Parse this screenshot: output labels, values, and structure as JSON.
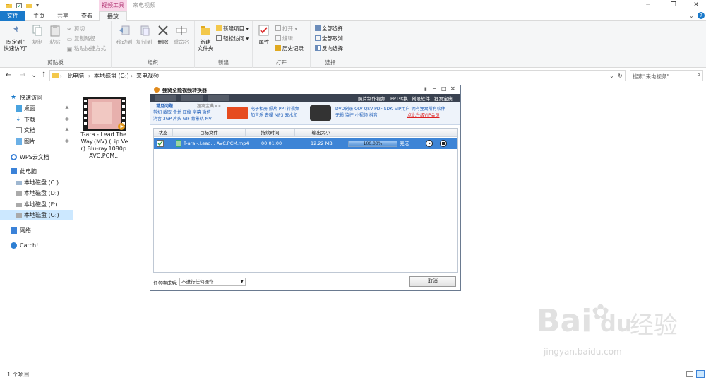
{
  "titlebar": {
    "context_tab": "视频工具",
    "window_title": "来电视频",
    "minimize": "─",
    "maximize": "❐",
    "close": "✕"
  },
  "tabs": [
    "文件",
    "主页",
    "共享",
    "查看",
    "播放"
  ],
  "ribbon": {
    "clipboard": {
      "label": "剪贴板",
      "pin": "固定到\"\n快速访问\"",
      "copy": "复制",
      "paste": "粘贴",
      "cut": "剪切",
      "copy_path": "复制路径",
      "paste_shortcut": "粘贴快捷方式"
    },
    "organize": {
      "label": "组织",
      "move_to": "移动到",
      "copy_to": "复制到",
      "delete": "删除",
      "rename": "重命名"
    },
    "new": {
      "label": "新建",
      "new_folder": "新建\n文件夹",
      "new_item": "新建项目 ▾",
      "easy_access": "轻松访问 ▾"
    },
    "open": {
      "label": "打开",
      "properties": "属性",
      "open": "打开 ▾",
      "edit": "编辑",
      "history": "历史记录"
    },
    "select": {
      "label": "选择",
      "select_all": "全部选择",
      "select_none": "全部取消",
      "invert": "反向选择"
    }
  },
  "address": {
    "back": "←",
    "forward": "→",
    "recent": "⌄",
    "up": "↑",
    "crumbs": [
      "此电脑",
      "本地磁盘 (G:)",
      "来电视频"
    ],
    "search_placeholder": "搜索\"来电视频\""
  },
  "nav": {
    "quick_access": "快速访问",
    "desktop": "桌面",
    "downloads": "下载",
    "documents": "文档",
    "pictures": "图片",
    "wps": "WPS云文档",
    "this_pc": "此电脑",
    "drive_c": "本地磁盘 (C:)",
    "drive_d": "本地磁盘 (D:)",
    "drive_f": "本地磁盘 (F:)",
    "drive_g": "本地磁盘 (G:)",
    "network": "网络",
    "catch": "Catch!"
  },
  "file": {
    "name": "T-ara.-.Lead.The.Way.(MV).(Lip.Ver).Blu-ray.1080p.AVC.PCM..."
  },
  "converter": {
    "title": "狸窝全能视频转换器",
    "links": [
      "照片制作视频",
      "PPT转换",
      "刻录软件",
      "狸窝宝典"
    ],
    "ad": {
      "tab1": "常见问题",
      "tab2": "狸窝宝典>>",
      "row1": "剪切 截取 合并 压缩 字幕 微信",
      "row2": "消音 3GP 片头 GIF 背景轨 MV",
      "mid1": "电子相册 照片 PPT转视频",
      "mid2": "加音乐 去噪 MP3 去水印",
      "right1": "DVD刻录 QLV QSV PDF SDK",
      "right2": "无损 监控 小视频 抖音",
      "vip1": "VIP用户-拥有狸窝所有软件",
      "vip2": "点此升级VIP会员"
    },
    "columns": [
      "状态",
      "目标文件",
      "持续时间",
      "输出大小"
    ],
    "row": {
      "file": "T-ara.-.Lead... AVC.PCM.mp4",
      "duration": "00:01:00",
      "size": "12.22 MB",
      "progress_text": "100.00%",
      "progress": 1.0,
      "status": "完成"
    },
    "after_label": "任务完成后:",
    "after_value": "不进行任何操作",
    "cancel": "取消"
  },
  "status": {
    "count": "1 个项目"
  },
  "watermark": {
    "brand": "Bai",
    "brand2": "du",
    "cn": "经验",
    "url": "jingyan.baidu.com"
  }
}
